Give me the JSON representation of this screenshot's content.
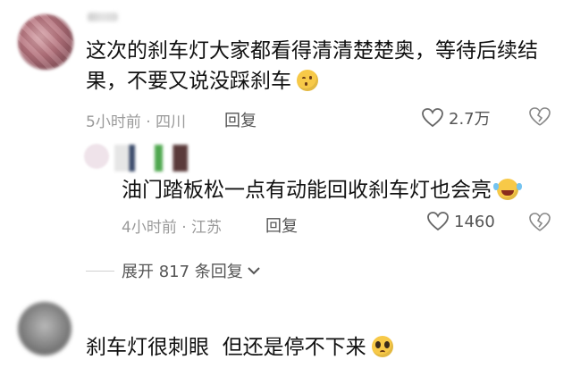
{
  "comments": [
    {
      "text_line1": "这次的刹车灯大家都看得清清楚楚奥，等待后续结",
      "text_line2": "果，不要又说没踩刹车",
      "emoji": "wink-smile-emoji",
      "time": "5小时前",
      "sep": "·",
      "location": "四川",
      "reply_label": "回复",
      "like_count": "2.7万"
    },
    {
      "text": "油门踏板松一点有动能回收刹车灯也会亮",
      "emoji": "laugh-tears-emoji",
      "time": "4小时前",
      "sep": "·",
      "location": "江苏",
      "reply_label": "回复",
      "like_count": "1460"
    },
    {
      "text": "刹车灯很刺眼  但还是停不下来",
      "emoji": "pleading-face-emoji"
    }
  ],
  "expand": {
    "label": "展开 817 条回复"
  }
}
